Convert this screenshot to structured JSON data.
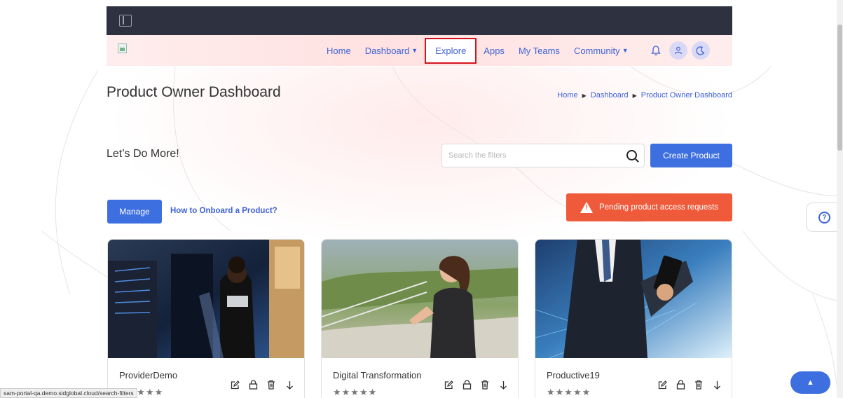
{
  "nav": {
    "items": [
      {
        "label": "Home",
        "dropdown": false
      },
      {
        "label": "Dashboard",
        "dropdown": true
      },
      {
        "label": "Explore",
        "dropdown": false,
        "highlighted": true
      },
      {
        "label": "Apps",
        "dropdown": false
      },
      {
        "label": "My Teams",
        "dropdown": false
      },
      {
        "label": "Community",
        "dropdown": true
      }
    ],
    "icons": [
      "bell-icon",
      "user-icon",
      "moon-icon"
    ]
  },
  "page": {
    "title": "Product Owner Dashboard",
    "breadcrumb": [
      "Home",
      "Dashboard",
      "Product Owner Dashboard"
    ],
    "subheading": "Let’s Do More!"
  },
  "search": {
    "placeholder": "Search the filters",
    "value": ""
  },
  "buttons": {
    "create": "Create Product",
    "manage": "Manage",
    "onboard_link": "How to Onboard a Product?",
    "pending": "Pending product access requests"
  },
  "cards": [
    {
      "title": "ProviderDemo",
      "stars": "★★★★★"
    },
    {
      "title": "Digital Transformation",
      "stars": "★★★★★"
    },
    {
      "title": "Productive19",
      "stars": "★★★★★"
    }
  ],
  "status_url": "sam-portal-qa.demo.sidglobal.cloud/search-filters",
  "colors": {
    "primary": "#3e6fe0",
    "link": "#3e63d6",
    "warning": "#ef5a3a",
    "topbar": "#2e3240",
    "highlight": "#d5131d"
  }
}
